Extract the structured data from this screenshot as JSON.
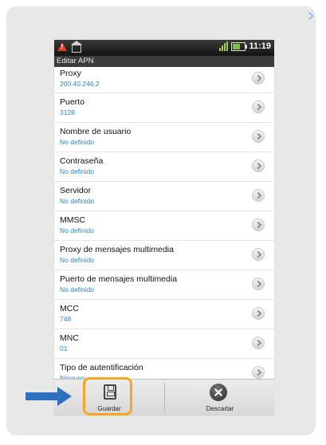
{
  "statusbar": {
    "time": "11:19",
    "icons": [
      "warning-icon",
      "home-icon",
      "signal-icon",
      "battery-icon"
    ]
  },
  "window": {
    "title": "Editar APN"
  },
  "settings": [
    {
      "label": "Proxy",
      "value": "200.40.246.2"
    },
    {
      "label": "Puerto",
      "value": "3128"
    },
    {
      "label": "Nombre de usuario",
      "value": "No definido"
    },
    {
      "label": "Contraseña",
      "value": "No definido"
    },
    {
      "label": "Servidor",
      "value": "No definido"
    },
    {
      "label": "MMSC",
      "value": "No definido"
    },
    {
      "label": "Proxy de mensajes multimedia",
      "value": "No definido"
    },
    {
      "label": "Puerto de mensajes multimedia",
      "value": "No definido"
    },
    {
      "label": "MCC",
      "value": "748"
    },
    {
      "label": "MNC",
      "value": "01"
    },
    {
      "label": "Tipo de autentificación",
      "value": "Ninguno"
    }
  ],
  "actions": {
    "save_label": "Guardar",
    "discard_label": "Descartar"
  },
  "colors": {
    "accent_value": "#2f86c9",
    "highlight": "#f5a623",
    "pointer_arrow": "#2f6fc0"
  }
}
